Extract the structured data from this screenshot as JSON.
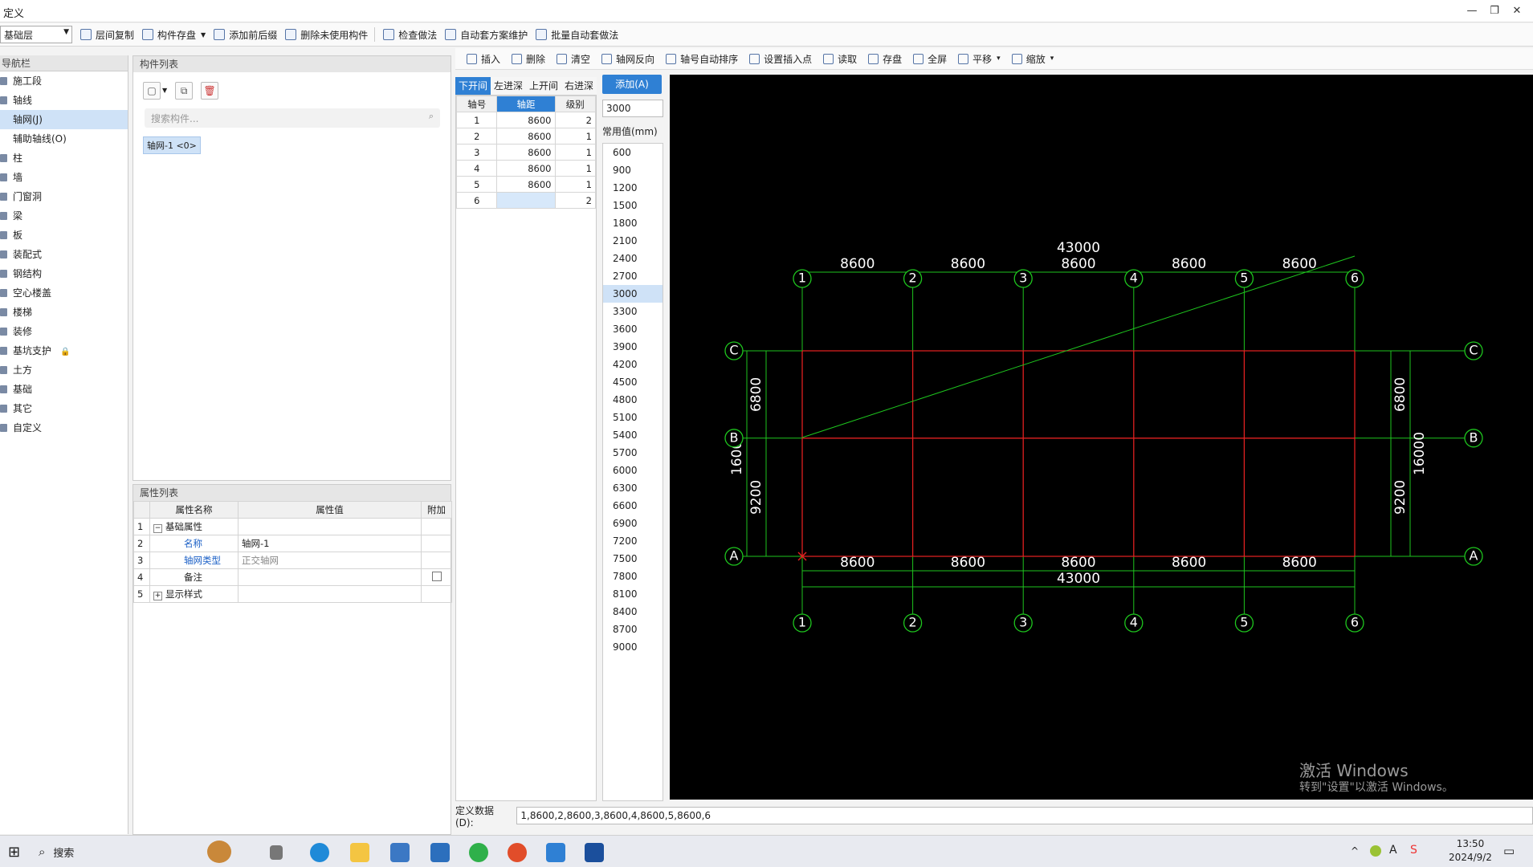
{
  "window": {
    "title": "定义",
    "min": "—",
    "restore": "❐",
    "close": "✕"
  },
  "toolbar1": {
    "floor": "基础层",
    "buttons": [
      "层间复制",
      "构件存盘",
      "添加前后缀",
      "删除未使用构件",
      "检查做法",
      "自动套方案维护",
      "批量自动套做法"
    ]
  },
  "nav": {
    "title": "导航栏",
    "items": [
      {
        "label": "施工段",
        "selected": false
      },
      {
        "label": "轴线",
        "selected": false
      },
      {
        "label": "轴网(J)",
        "selected": true
      },
      {
        "label": "辅助轴线(O)",
        "selected": false
      },
      {
        "label": "柱",
        "selected": false
      },
      {
        "label": "墙",
        "selected": false
      },
      {
        "label": "门窗洞",
        "selected": false
      },
      {
        "label": "梁",
        "selected": false
      },
      {
        "label": "板",
        "selected": false
      },
      {
        "label": "装配式",
        "selected": false
      },
      {
        "label": "钢结构",
        "selected": false
      },
      {
        "label": "空心楼盖",
        "selected": false
      },
      {
        "label": "楼梯",
        "selected": false
      },
      {
        "label": "装修",
        "selected": false
      },
      {
        "label": "基坑支护",
        "selected": false
      },
      {
        "label": "土方",
        "selected": false
      },
      {
        "label": "基础",
        "selected": false
      },
      {
        "label": "其它",
        "selected": false
      },
      {
        "label": "自定义",
        "selected": false
      }
    ]
  },
  "components": {
    "title": "构件列表",
    "search_placeholder": "搜索构件...",
    "selected": "轴网-1 <0>"
  },
  "properties": {
    "title": "属性列表",
    "headers": [
      "属性名称",
      "属性值",
      "附加"
    ],
    "rows": [
      {
        "n": "1",
        "name": "基础属性",
        "value": "",
        "expander": "−",
        "blue": false
      },
      {
        "n": "2",
        "name": "名称",
        "value": "轴网-1",
        "expander": "",
        "blue": true
      },
      {
        "n": "3",
        "name": "轴网类型",
        "value": "正交轴网",
        "expander": "",
        "blue": true
      },
      {
        "n": "4",
        "name": "备注",
        "value": "",
        "expander": "",
        "blue": false
      },
      {
        "n": "5",
        "name": "显示样式",
        "value": "",
        "expander": "+",
        "blue": false
      }
    ]
  },
  "toolbar2": {
    "buttons": [
      "插入",
      "删除",
      "清空",
      "轴网反向",
      "轴号自动排序",
      "设置插入点",
      "读取",
      "存盘",
      "全屏",
      "平移",
      "缩放"
    ]
  },
  "axis_tabs": [
    "下开间",
    "左进深",
    "上开间",
    "右进深"
  ],
  "axis_table": {
    "headers": [
      "轴号",
      "轴距",
      "级别"
    ],
    "rows": [
      {
        "no": "1",
        "dist": "8600",
        "level": "2"
      },
      {
        "no": "2",
        "dist": "8600",
        "level": "1"
      },
      {
        "no": "3",
        "dist": "8600",
        "level": "1"
      },
      {
        "no": "4",
        "dist": "8600",
        "level": "1"
      },
      {
        "no": "5",
        "dist": "8600",
        "level": "1"
      },
      {
        "no": "6",
        "dist": "",
        "level": "2"
      }
    ]
  },
  "add_button": "添加(A)",
  "input_value": "3000",
  "common_label": "常用值(mm)",
  "common_values": [
    "600",
    "900",
    "1200",
    "1500",
    "1800",
    "2100",
    "2400",
    "2700",
    "3000",
    "3300",
    "3600",
    "3900",
    "4200",
    "4500",
    "4800",
    "5100",
    "5400",
    "5700",
    "6000",
    "6300",
    "6600",
    "6900",
    "7200",
    "7500",
    "7800",
    "8100",
    "8400",
    "8700",
    "9000"
  ],
  "common_selected": "3000",
  "grid": {
    "x_axes": [
      "1",
      "2",
      "3",
      "4",
      "5",
      "6"
    ],
    "x_spans": [
      "8600",
      "8600",
      "8600",
      "8600",
      "8600"
    ],
    "x_total": "43000",
    "y_axes": [
      "A",
      "B",
      "C"
    ],
    "y_spans": [
      "9200",
      "6800"
    ],
    "y_total": "16000"
  },
  "define_data": {
    "label": "定义数据(D):",
    "value": "1,8600,2,8600,3,8600,4,8600,5,8600,6"
  },
  "watermark": {
    "line1": "激活 Windows",
    "line2": "转到\"设置\"以激活 Windows。"
  },
  "taskbar": {
    "search": "搜索",
    "time": "13:50",
    "date": "2024/9/2"
  }
}
